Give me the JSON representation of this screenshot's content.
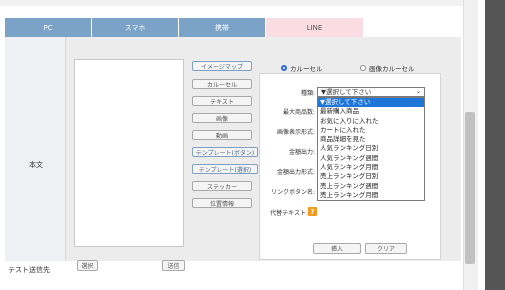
{
  "tabs": [
    {
      "label": "PC"
    },
    {
      "label": "スマホ"
    },
    {
      "label": "携帯"
    },
    {
      "label": "LINE",
      "active": true
    }
  ],
  "form": {
    "label_body": "本文",
    "label_test": "テスト送信先"
  },
  "insert_buttons": {
    "image_map": "イメージマップ",
    "carousel": "カルーセル",
    "text": "テキスト",
    "table": "画像",
    "video": "動画",
    "template_button": "テンプレート(ボタン)",
    "template_select": "テンプレート(選択)",
    "sticker": "ステッカー",
    "location": "位置情報"
  },
  "panel": {
    "radio_carousel": "カルーセル",
    "radio_image_carousel": "画像カルーセル",
    "field_type": "種類:",
    "field_max_products": "最大商品数:",
    "field_image_display": "画像表示形式:",
    "field_price_output": "金額出力:",
    "field_price_format": "金額出力形式:",
    "field_link_button": "リンクボタン名:",
    "field_alt_text": "代替テキスト:",
    "insert_button": "挿入",
    "clear_button": "クリア",
    "help_icon": "?"
  },
  "select": {
    "value": "▼選択して下さい",
    "options": [
      "▼選択して下さい",
      "最新購入商品",
      "お気に入りに入れた",
      "カートに入れた",
      "商品詳細を見た",
      "人気ランキング日別",
      "人気ランキング週間",
      "人気ランキング月間",
      "売上ランキング日別",
      "売上ランキング週間",
      "売上ランキング月間"
    ],
    "highlighted_index": 0
  },
  "test": {
    "select_button": "選択",
    "send_button": "送信"
  },
  "colors": {
    "tab_bg": "#7aa3c7",
    "tab_active_bg": "#f9dde2",
    "highlight": "#1e76d8",
    "help_icon": "#f29a1d"
  }
}
